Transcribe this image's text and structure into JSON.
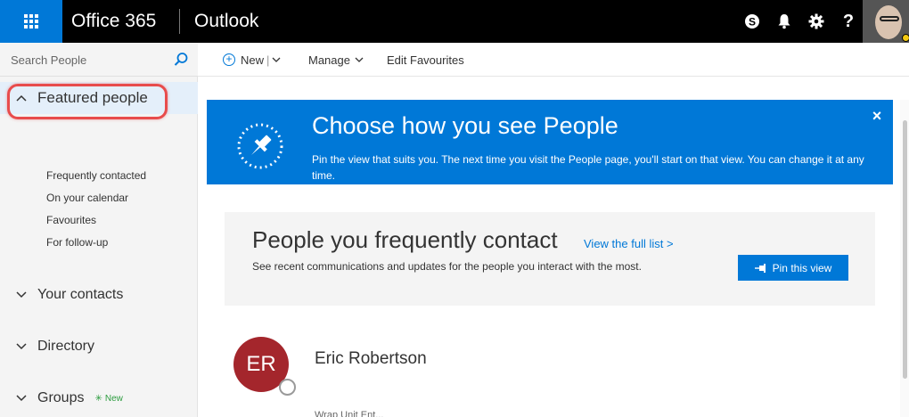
{
  "topbar": {
    "brand": "Office 365",
    "app_name": "Outlook"
  },
  "search": {
    "placeholder": "Search People"
  },
  "sidebar": {
    "featured": {
      "label": "Featured people",
      "items": [
        "Frequently contacted",
        "On your calendar",
        "Favourites",
        "For follow-up"
      ]
    },
    "sections": [
      {
        "label": "Your contacts"
      },
      {
        "label": "Directory"
      },
      {
        "label": "Groups",
        "badge": "New"
      }
    ]
  },
  "commands": {
    "new_label": "New",
    "manage_label": "Manage",
    "edit_favourites_label": "Edit Favourites"
  },
  "banner": {
    "title": "Choose how you see People",
    "text": "Pin the view that suits you. The next time you visit the People page, you'll start on that view. You can change it at any time.",
    "close": "×"
  },
  "card": {
    "title": "People you frequently contact",
    "link": "View the full list >",
    "description": "See recent communications and updates for the people you interact with the most.",
    "pin_button": "Pin this view"
  },
  "person": {
    "initials": "ER",
    "name": "Eric Robertson",
    "subtitle": "Wrap Unit Ent..."
  },
  "colors": {
    "accent": "#0078d7",
    "avatar_bg": "#a4262c",
    "highlight": "#e84c4c",
    "new_badge": "#2c9c3f"
  },
  "icons": {
    "waffle": "app-launcher-icon",
    "skype": "skype-icon",
    "bell": "notification-bell-icon",
    "gear": "settings-gear-icon",
    "help": "help-icon",
    "search": "search-icon",
    "pin": "pin-icon"
  }
}
